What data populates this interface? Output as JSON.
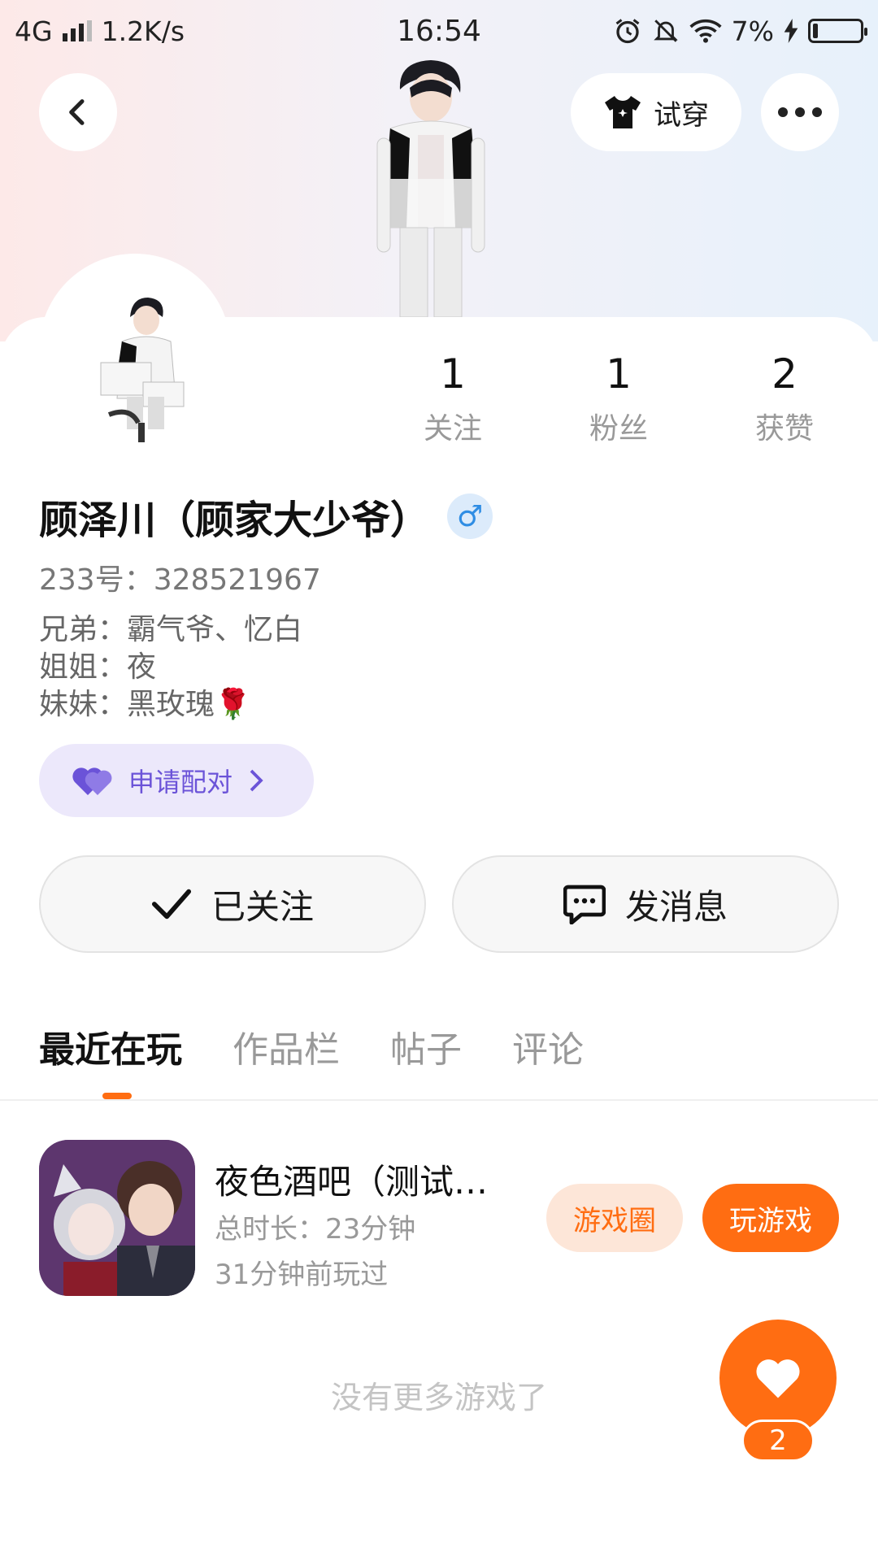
{
  "status_bar": {
    "network": "4G",
    "speed": "1.2K/s",
    "time": "16:54",
    "battery": "7%"
  },
  "top_bar": {
    "tryon_label": "试穿"
  },
  "stats": [
    {
      "value": "1",
      "label": "关注"
    },
    {
      "value": "1",
      "label": "粉丝"
    },
    {
      "value": "2",
      "label": "获赞"
    }
  ],
  "profile": {
    "name": "顾泽川（顾家大少爷）",
    "gender_symbol": "♂",
    "uid": "233号：328521967",
    "bio": [
      "兄弟：霸气爷、忆白",
      "姐姐：夜",
      "妹妹：黑玫瑰🌹"
    ]
  },
  "pair_button": {
    "label": "申请配对"
  },
  "actions": {
    "follow_label": "已关注",
    "message_label": "发消息"
  },
  "tabs": [
    "最近在玩",
    "作品栏",
    "帖子",
    "评论"
  ],
  "games": [
    {
      "title": "夜色酒吧（测试…",
      "duration": "总时长：23分钟",
      "last_played": "31分钟前玩过",
      "circle_label": "游戏圈",
      "play_label": "玩游戏"
    }
  ],
  "end_text": "没有更多游戏了",
  "like": {
    "count": "2"
  },
  "colors": {
    "accent": "#ff6d12",
    "pair_purple": "#6b53d8",
    "gender_blue": "#2f8de4"
  }
}
